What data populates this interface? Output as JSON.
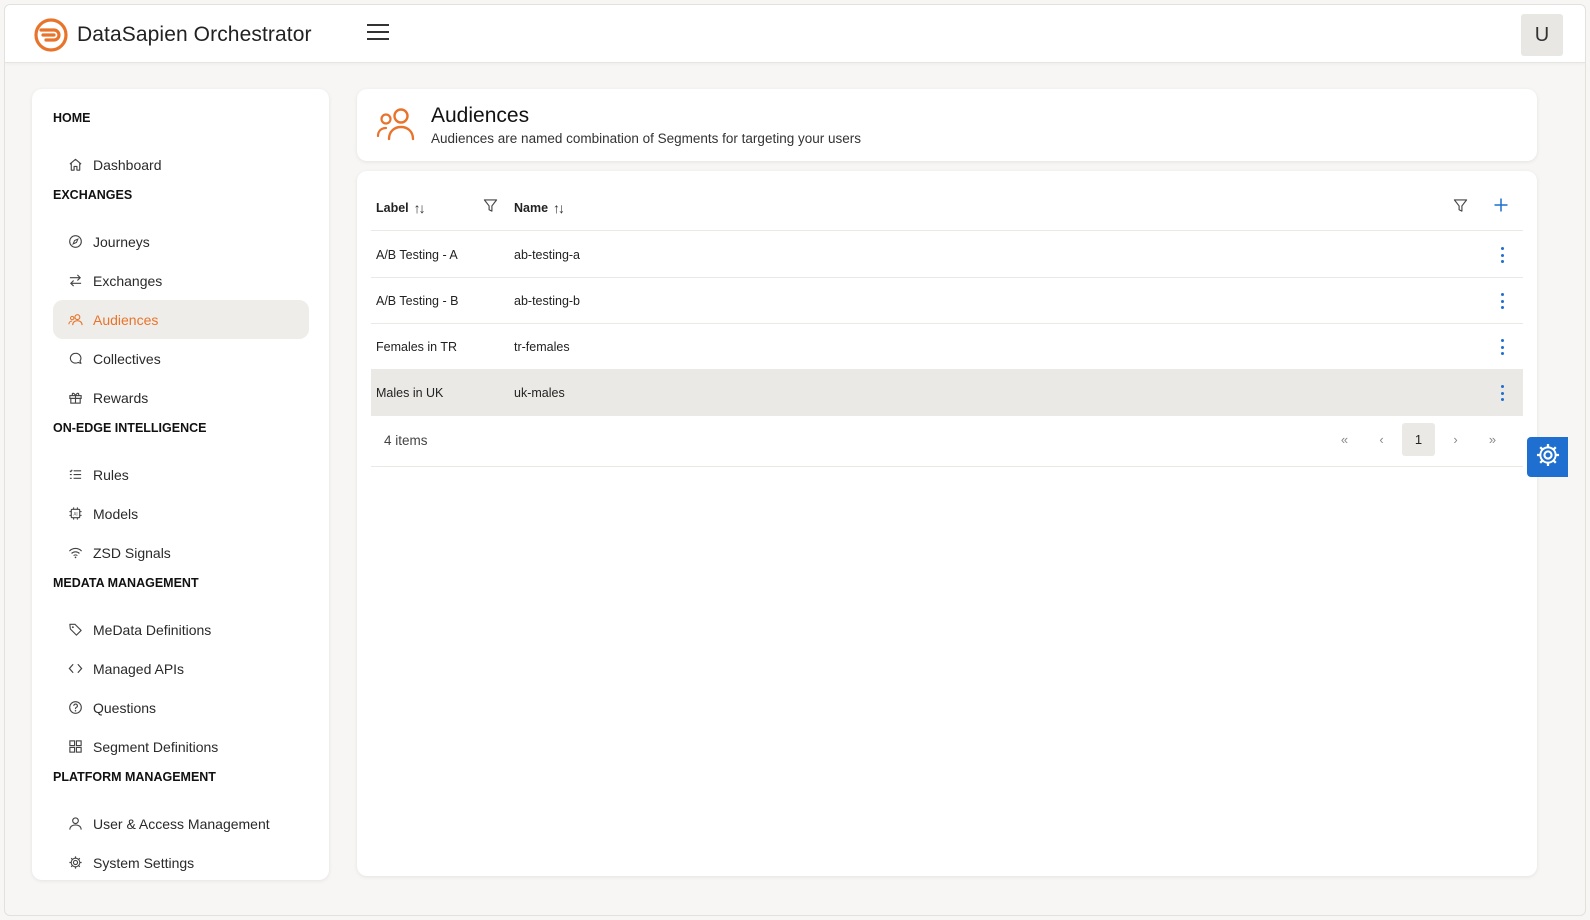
{
  "app": {
    "title": "DataSapien Orchestrator",
    "user_initial": "U",
    "brand_color": "#e8742b",
    "accent_color": "#1e6fd0"
  },
  "sidebar": {
    "sections": [
      {
        "title": "HOME",
        "items": [
          {
            "label": "Dashboard",
            "icon": "home-icon"
          }
        ]
      },
      {
        "title": "EXCHANGES",
        "items": [
          {
            "label": "Journeys",
            "icon": "compass-icon"
          },
          {
            "label": "Exchanges",
            "icon": "arrows-exchange-icon"
          },
          {
            "label": "Audiences",
            "icon": "users-icon",
            "active": true
          },
          {
            "label": "Collectives",
            "icon": "chat-icon"
          },
          {
            "label": "Rewards",
            "icon": "gift-icon"
          }
        ]
      },
      {
        "title": "ON-EDGE INTELLIGENCE",
        "items": [
          {
            "label": "Rules",
            "icon": "list-check-icon"
          },
          {
            "label": "Models",
            "icon": "ai-chip-icon"
          },
          {
            "label": "ZSD Signals",
            "icon": "wifi-icon"
          }
        ]
      },
      {
        "title": "MEDATA MANAGEMENT",
        "items": [
          {
            "label": "MeData Definitions",
            "icon": "tag-icon"
          },
          {
            "label": "Managed APIs",
            "icon": "code-icon"
          },
          {
            "label": "Questions",
            "icon": "question-circle-icon"
          },
          {
            "label": "Segment Definitions",
            "icon": "grid-icon"
          }
        ]
      },
      {
        "title": "PLATFORM MANAGEMENT",
        "items": [
          {
            "label": "User & Access Management",
            "icon": "user-icon"
          },
          {
            "label": "System Settings",
            "icon": "gear-icon"
          }
        ]
      }
    ]
  },
  "page": {
    "title": "Audiences",
    "subtitle": "Audiences are named combination of Segments for targeting your users"
  },
  "table": {
    "columns": {
      "label": "Label",
      "name": "Name"
    },
    "sort_glyph": "↑↓",
    "rows": [
      {
        "label": "A/B Testing - A",
        "name": "ab-testing-a"
      },
      {
        "label": "A/B Testing - B",
        "name": "ab-testing-b"
      },
      {
        "label": "Females in TR",
        "name": "tr-females"
      },
      {
        "label": "Males in UK",
        "name": "uk-males",
        "highlighted": true
      }
    ],
    "item_count": "4 items",
    "pagination": {
      "first": "«",
      "prev": "‹",
      "current": "1",
      "next": "›",
      "last": "»"
    }
  }
}
